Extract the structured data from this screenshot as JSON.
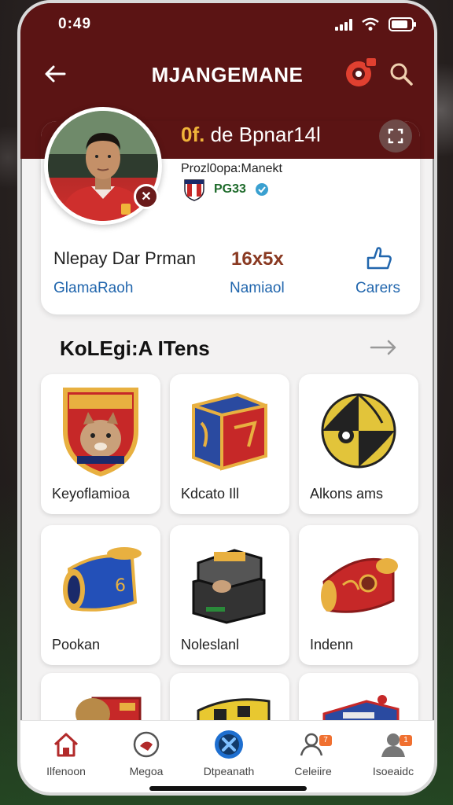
{
  "status_bar": {
    "time": "0:49"
  },
  "header": {
    "title": "MJANGEMANE"
  },
  "profile": {
    "name_highlight": "0f.",
    "name_rest": "de Bpnar14l",
    "subtitle": "Prozl0opa:Manekt",
    "club_code": "PG33",
    "stats": [
      {
        "title": "Nlepay Dar Prman",
        "link": "GlamaRaoh"
      },
      {
        "value": "16x5x",
        "link": "Namiaol"
      },
      {
        "link": "Carers"
      }
    ]
  },
  "section": {
    "title": "KoLEgi:A ITens"
  },
  "items": [
    {
      "label": "Keyoflamioa",
      "icon": "wolf-crest-icon"
    },
    {
      "label": "Kdcato  Ill",
      "icon": "mystery-box-icon"
    },
    {
      "label": "Alkons ams",
      "icon": "soccer-ball-icon"
    },
    {
      "label": "Pookan",
      "icon": "blue-canister-icon"
    },
    {
      "label": "Noleslanl",
      "icon": "treasure-chest-icon"
    },
    {
      "label": "Indenn",
      "icon": "red-scroll-icon"
    },
    {
      "label": "",
      "icon": "red-drum-icon"
    },
    {
      "label": "",
      "icon": "yellow-pack-icon"
    },
    {
      "label": "",
      "icon": "blue-box-icon"
    }
  ],
  "nav": [
    {
      "label": "Ilfenoon",
      "icon": "home-icon"
    },
    {
      "label": "Megoa",
      "icon": "ball-icon"
    },
    {
      "label": "Dtpeanath",
      "icon": "x-circle-icon"
    },
    {
      "label": "Celeiire",
      "icon": "friends-icon",
      "badge": "7"
    },
    {
      "label": "Isoeaidc",
      "icon": "profile-icon",
      "badge": "1"
    }
  ],
  "colors": {
    "header_bg": "#5b1414",
    "accent_gold": "#f0b43a",
    "link_blue": "#2166ad"
  }
}
